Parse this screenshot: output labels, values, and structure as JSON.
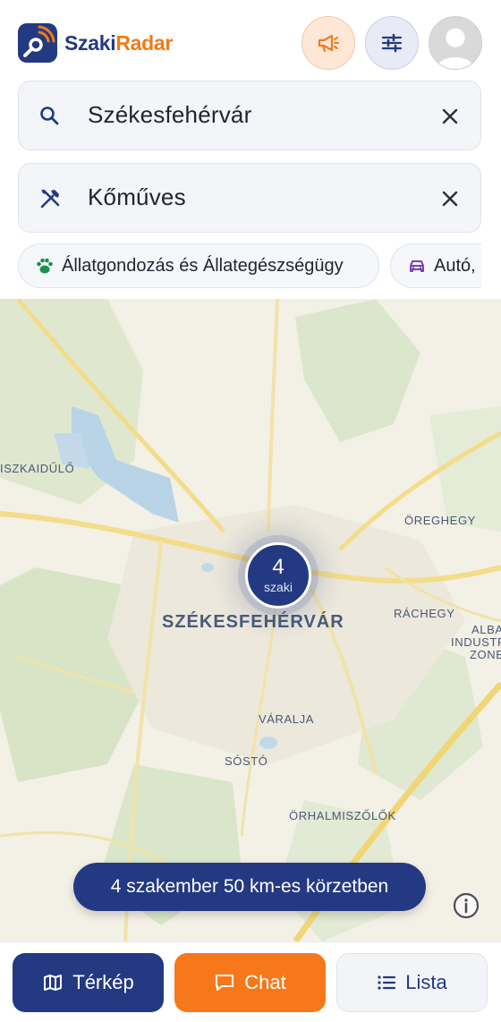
{
  "header": {
    "brand_part1": "Szaki",
    "brand_part2": "Radar",
    "promo_icon": "megaphone-icon",
    "filter_icon": "sliders-icon",
    "avatar_icon": "user-avatar-icon"
  },
  "search": {
    "location_value": "Székesfehérvár",
    "location_icon": "search-icon",
    "trade_value": "Kőműves",
    "trade_icon": "tools-icon",
    "clear_icon": "close-icon"
  },
  "categories": [
    {
      "label": "Állatgondozás és Állategészségügy",
      "icon": "paw-icon",
      "color": "#1f8f4e"
    },
    {
      "label": "Autó, ",
      "icon": "car-icon",
      "color": "#7b3fb8"
    }
  ],
  "map": {
    "places": {
      "city": "SZÉKESFEHÉRVÁR",
      "p1": "ISZKAIDŰLŐ",
      "p2": "ÖREGHEGY",
      "p3": "RÁCHEGY",
      "p4a": "ALBA",
      "p4b": "INDUSTR",
      "p4c": "ZONE",
      "p5": "VÁRALJA",
      "p6": "SÓSTÓ",
      "p7": "ÖRHALMISZŐLŐK"
    },
    "cluster_count": "4",
    "cluster_unit": "szaki",
    "radius_text": "4 szakember 50 km-es körzetben",
    "info_icon": "info-icon"
  },
  "bottom_nav": {
    "map_label": "Térkép",
    "chat_label": "Chat",
    "list_label": "Lista"
  },
  "colors": {
    "brand_navy": "#233a82",
    "brand_orange": "#f07a16"
  }
}
